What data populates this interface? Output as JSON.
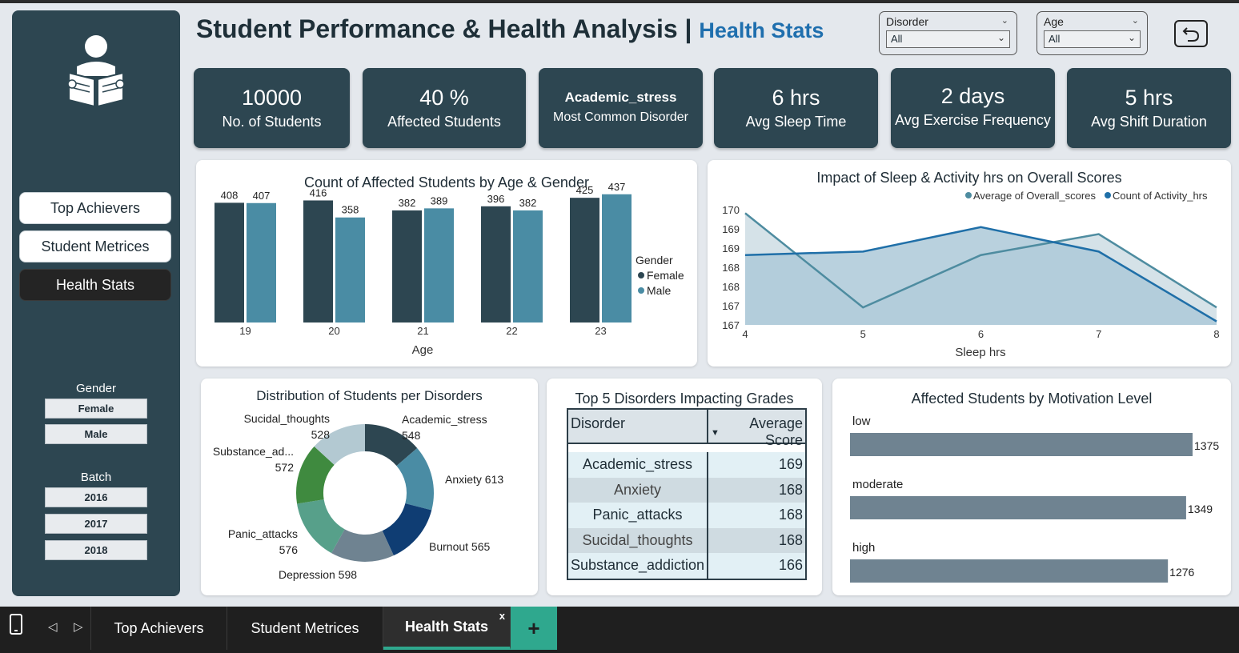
{
  "header": {
    "title": "Student Performance & Health Analysis",
    "separator": "|",
    "subtitle": "Health Stats"
  },
  "filters": [
    {
      "label": "Disorder",
      "value": "All"
    },
    {
      "label": "Age",
      "value": "All"
    }
  ],
  "sidebar": {
    "nav": [
      {
        "label": "Top Achievers",
        "active": false
      },
      {
        "label": "Student Metrices",
        "active": false
      },
      {
        "label": "Health Stats",
        "active": true
      }
    ],
    "gender_label": "Gender",
    "gender_options": [
      "Female",
      "Male"
    ],
    "batch_label": "Batch",
    "batch_options": [
      "2016",
      "2017",
      "2018"
    ]
  },
  "kpis": [
    {
      "value": "10000",
      "label": "No. of Students"
    },
    {
      "value": "40 %",
      "label": "Affected Students"
    },
    {
      "value": "Academic_stress",
      "label": "Most Common Disorder"
    },
    {
      "value": "6 hrs",
      "label": "Avg Sleep Time"
    },
    {
      "value": "2 days",
      "label": "Avg Exercise Frequency"
    },
    {
      "value": "5 hrs",
      "label": "Avg Shift Duration"
    }
  ],
  "chart_data": [
    {
      "type": "bar",
      "title": "Count of Affected Students by Age & Gender",
      "xlabel": "Age",
      "categories": [
        "19",
        "20",
        "21",
        "22",
        "23"
      ],
      "legend_title": "Gender",
      "legend_position": "right",
      "ylim": [
        0,
        450
      ],
      "series": [
        {
          "name": "Female",
          "color": "#2d4651",
          "values": [
            408,
            416,
            382,
            396,
            425
          ]
        },
        {
          "name": "Male",
          "color": "#4a8ca4",
          "values": [
            407,
            358,
            389,
            382,
            437
          ]
        }
      ]
    },
    {
      "type": "area",
      "title": "Impact of Sleep & Activity hrs on Overall Scores",
      "xlabel": "Sleep hrs",
      "x": [
        4,
        5,
        6,
        7,
        8
      ],
      "y_ticks": [
        "170",
        "169",
        "169",
        "168",
        "168",
        "167",
        "167"
      ],
      "ylim": [
        166.9,
        170.2
      ],
      "legend_position": "top-right",
      "series": [
        {
          "name": "Average of Overall_scores",
          "color": "#4e8ca0",
          "values": [
            170.1,
            167.4,
            168.9,
            169.5,
            167.4
          ]
        },
        {
          "name": "Count of Activity_hrs",
          "color": "#1f6fa8",
          "values": [
            168.9,
            169.0,
            169.7,
            169.0,
            167.0
          ]
        }
      ]
    },
    {
      "type": "pie",
      "title": "Distribution of Students per Disorders",
      "slices": [
        {
          "label": "Academic_stress",
          "value": 548,
          "color": "#2d4651"
        },
        {
          "label": "Anxiety",
          "value": 613,
          "color": "#4a8ca4"
        },
        {
          "label": "Burnout",
          "value": 565,
          "color": "#0f3d73"
        },
        {
          "label": "Depression",
          "value": 598,
          "color": "#6f8391"
        },
        {
          "label": "Panic_attacks",
          "value": 576,
          "color": "#57a08a"
        },
        {
          "label": "Substance_ad...",
          "value": 572,
          "color": "#3f8a3f"
        },
        {
          "label": "Sucidal_thoughts",
          "value": 528,
          "color": "#b3c9d2"
        }
      ]
    },
    {
      "type": "table",
      "title": "Top 5 Disorders Impacting Grades",
      "columns": [
        "Disorder",
        "Average Score"
      ],
      "rows": [
        [
          "Academic_stress",
          "169"
        ],
        [
          "Anxiety",
          "168"
        ],
        [
          "Panic_attacks",
          "168"
        ],
        [
          "Sucidal_thoughts",
          "168"
        ],
        [
          "Substance_addiction",
          "166"
        ]
      ]
    },
    {
      "type": "bar",
      "orientation": "horizontal",
      "title": "Affected Students by Motivation Level",
      "categories": [
        "low",
        "moderate",
        "high"
      ],
      "values": [
        1375,
        1349,
        1276
      ],
      "color": "#6f8391",
      "xlim": [
        0,
        1375
      ]
    }
  ],
  "tabs": [
    {
      "label": "Top Achievers",
      "active": false
    },
    {
      "label": "Student Metrices",
      "active": false
    },
    {
      "label": "Health Stats",
      "active": true
    }
  ],
  "tab_close": "x",
  "tab_add": "+"
}
